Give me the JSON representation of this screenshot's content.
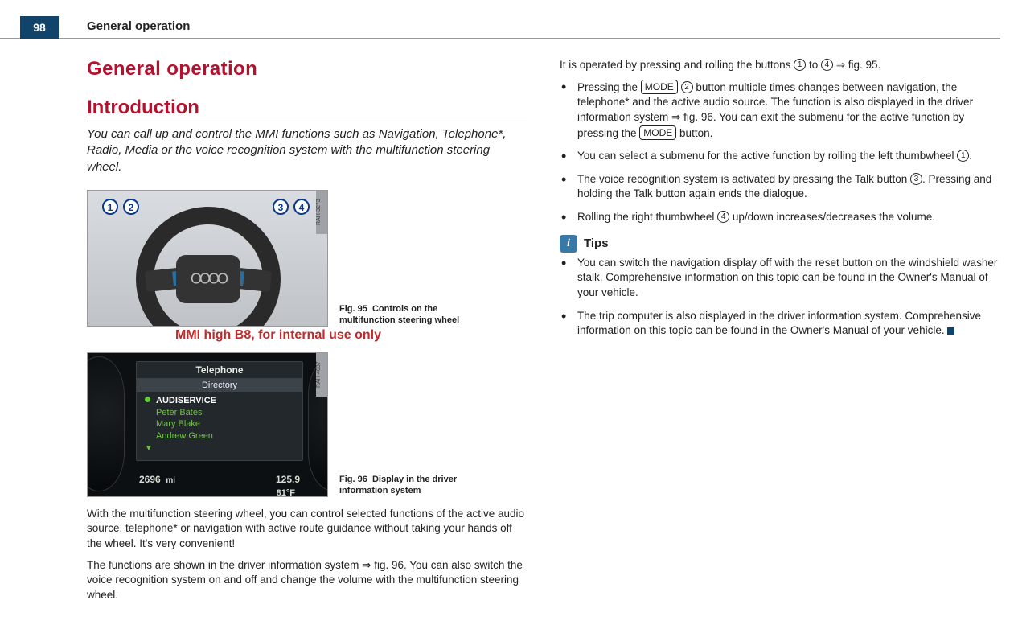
{
  "page_number": "98",
  "running_head": "General operation",
  "title": "General operation",
  "section": "Introduction",
  "lead": "You can call up and control the MMI functions such as Navigation, Telephone*, Radio, Media or the voice recognition system with the multifunction steering wheel.",
  "watermark": "MMI high B8, for internal use only",
  "fig95": {
    "label": "Fig. 95",
    "caption": "Controls on the multifunction steering wheel",
    "imgcode": "RAH-3273",
    "callouts": [
      "1",
      "2",
      "3",
      "4"
    ]
  },
  "fig96": {
    "label": "Fig. 96",
    "caption": "Display in the driver information system",
    "imgcode": "RAH-4037",
    "panel_title": "Telephone",
    "panel_sub": "Directory",
    "entries": [
      "AUDISERVICE",
      "Peter Bates",
      "Mary Blake",
      "Andrew Green"
    ],
    "odo": "2696",
    "odo_unit": "mi",
    "trip": "125.9",
    "temp": "81°F"
  },
  "body": {
    "p1": "With the multifunction steering wheel, you can control selected functions of the active audio source, telephone* or navigation with active route guidance without taking your hands off the wheel. It's very convenient!",
    "p2a": "The functions are shown in the driver information system ",
    "p2b": " fig. 96. You can also switch the voice recognition system on and off and change the volume with the multifunction steering wheel.",
    "p3a": "It is operated by pressing and rolling the buttons ",
    "p3b": " to ",
    "p3c": " fig. 95.",
    "b1a": "Pressing the ",
    "mode": "MODE",
    "b1b": " button multiple times changes between navigation, the telephone* and the active audio source. The function is also displayed in the driver information system ",
    "b1c": " fig. 96. You can exit the submenu for the active function by pressing the ",
    "b1d": " button.",
    "b2a": "You can select a submenu for the active function by rolling the left thumbwheel ",
    "b2b": ".",
    "b3a": "The voice recognition system is activated by pressing the Talk button ",
    "b3b": ". Pressing and holding the Talk button again ends the dialogue.",
    "b4a": "Rolling the right thumbwheel ",
    "b4b": " up/down increases/decreases the volume."
  },
  "tips": {
    "label": "Tips",
    "t1": "You can switch the navigation display off with the reset button on the windshield washer stalk. Comprehensive information on this topic can be found in the Owner's Manual of your vehicle.",
    "t2": "The trip computer is also displayed in the driver information system. Comprehensive information on this topic can be found in the Owner's Manual of your vehicle."
  },
  "circles": {
    "c1": "1",
    "c2": "2",
    "c3": "3",
    "c4": "4"
  },
  "arrow": "⇒"
}
